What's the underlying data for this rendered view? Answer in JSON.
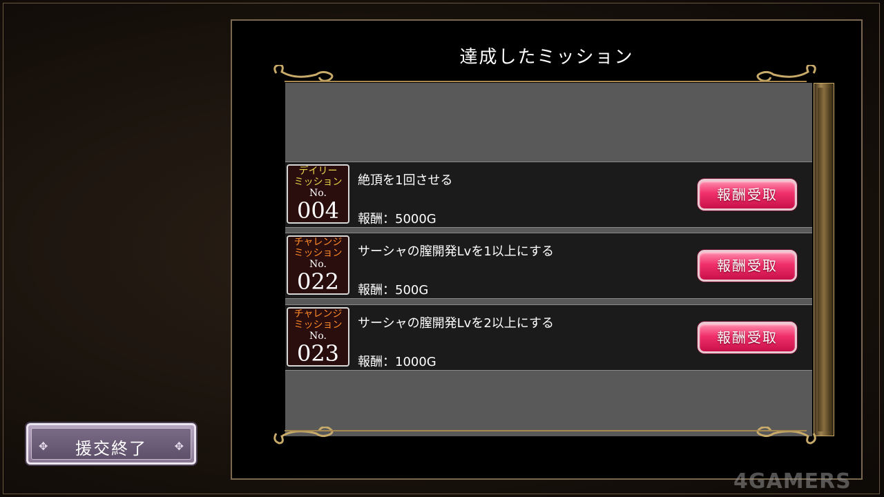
{
  "panel": {
    "title": "達成したミッション"
  },
  "missions": [
    {
      "type_line1": "デイリー",
      "type_line2": "ミッション",
      "no_label": "No.",
      "number": "004",
      "description": "絶頂を1回させる",
      "reward": "報酬：5000G",
      "button_label": "報酬受取"
    },
    {
      "type_line1": "チャレンジ",
      "type_line2": "ミッション",
      "no_label": "No.",
      "number": "022",
      "description": "サーシャの膣開発Lvを1以上にする",
      "reward": "報酬：500G",
      "button_label": "報酬受取"
    },
    {
      "type_line1": "チャレンジ",
      "type_line2": "ミッション",
      "no_label": "No.",
      "number": "023",
      "description": "サーシャの膣開発Lvを2以上にする",
      "reward": "報酬：1000G",
      "button_label": "報酬受取"
    }
  ],
  "footer": {
    "end_button_label": "援交終了"
  },
  "watermark": "4GAMERS",
  "colors": {
    "daily_accent": "#e8d54a",
    "challenge_accent": "#ff8a28",
    "claim_button": "#f0306a",
    "frame_gold": "#c8aa6a"
  },
  "icons": {
    "scroll": "scrollbar",
    "ornament": "flourish-ornament",
    "end_button_ornament": "diamond-ornament-icon"
  }
}
